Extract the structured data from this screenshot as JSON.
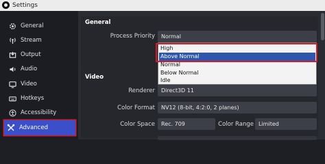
{
  "window": {
    "title": "Settings"
  },
  "sidebar": {
    "items": [
      {
        "label": "General",
        "icon": "gear-icon"
      },
      {
        "label": "Stream",
        "icon": "antenna-icon"
      },
      {
        "label": "Output",
        "icon": "output-icon"
      },
      {
        "label": "Audio",
        "icon": "speaker-icon"
      },
      {
        "label": "Video",
        "icon": "monitor-icon"
      },
      {
        "label": "Hotkeys",
        "icon": "keyboard-icon"
      },
      {
        "label": "Accessibility",
        "icon": "accessibility-icon"
      },
      {
        "label": "Advanced",
        "icon": "tools-icon",
        "active": true
      }
    ]
  },
  "general": {
    "title": "General",
    "process_priority": {
      "label": "Process Priority",
      "value": "Normal",
      "options": [
        "High",
        "Above Normal",
        "Normal",
        "Below Normal",
        "Idle"
      ],
      "highlighted": "Above Normal"
    }
  },
  "video": {
    "title": "Video",
    "renderer": {
      "label": "Renderer",
      "value": "Direct3D 11"
    },
    "color_format": {
      "label": "Color Format",
      "value": "NV12 (8-bit, 4:2:0, 2 planes)"
    },
    "color_space": {
      "label": "Color Space",
      "value": "Rec. 709"
    },
    "color_range": {
      "label": "Color Range",
      "value": "Limited"
    }
  },
  "colors": {
    "accent": "#3a4fc9",
    "highlight_red": "#d01c2b",
    "selection_blue": "#2e56ad"
  }
}
